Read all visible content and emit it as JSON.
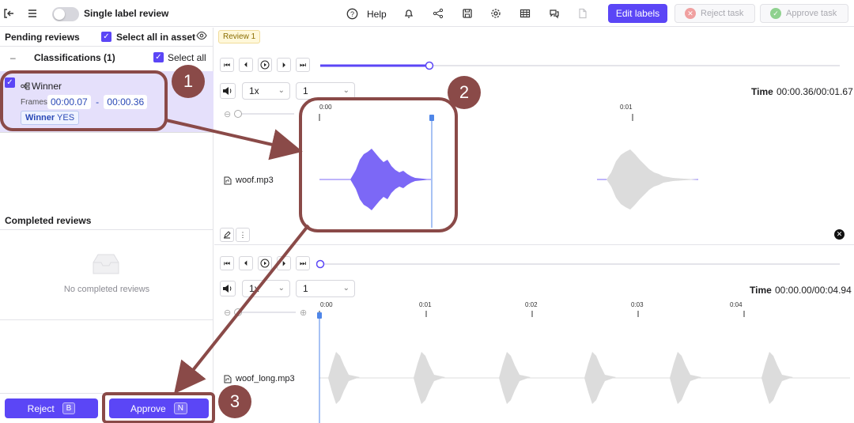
{
  "topbar": {
    "toggle_label": "Single label review",
    "help_label": "Help",
    "edit_labels": "Edit labels",
    "reject_task": "Reject task",
    "approve_task": "Approve task"
  },
  "left": {
    "pending_title": "Pending reviews",
    "select_all_asset": "Select all in asset",
    "classifications": "Classifications (1)",
    "select_all": "Select all",
    "item": {
      "name": "Winner",
      "frames_label": "Frames",
      "frame_start": "00:00.07",
      "frame_sep": "-",
      "frame_end": "00:00.36",
      "badge_key": "Winner",
      "badge_val": "YES"
    },
    "completed_title": "Completed reviews",
    "empty_text": "No completed reviews",
    "reject_label": "Reject",
    "reject_key": "B",
    "approve_label": "Approve",
    "approve_key": "N"
  },
  "review_tag": "Review 1",
  "track1": {
    "speed": "1x",
    "channel": "1",
    "time_label": "Time",
    "time_value": "00:00.36/00:01.67",
    "progress": 0.21,
    "tick_labels": [
      "0:00",
      "0:01"
    ],
    "file": "woof.mp3"
  },
  "track2": {
    "speed": "1x",
    "channel": "1",
    "time_label": "Time",
    "time_value": "00:00.00/00:04.94",
    "progress": 0,
    "tick_labels": [
      "0:00",
      "0:01",
      "0:02",
      "0:03",
      "0:04"
    ],
    "file": "woof_long.mp3"
  },
  "annotations": [
    "1",
    "2",
    "3"
  ],
  "colors": {
    "accent": "#5b46f6",
    "wave_active": "#7c68f6",
    "wave_inactive": "#dcdcdc",
    "annotation": "#8a4a48"
  }
}
